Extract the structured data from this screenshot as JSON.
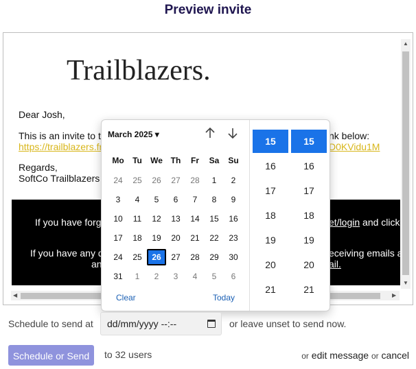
{
  "page_title": "Preview invite",
  "email": {
    "logo_text": "Trailblazers.",
    "greeting": "Dear Josh,",
    "intro_start": "This is an invite to t",
    "intro_end": "nk below:",
    "link_start": "https://trailblazers.fr",
    "link_end": "D0KVidu1M",
    "regards": "Regards,",
    "signature": "SoftCo Trailblazers",
    "footer_line1_start": "If you have forg",
    "footer_line1_link": "et/login",
    "footer_line1_end": " and click",
    "footer_line2_start": "If you have any q",
    "footer_line2_end": "eceiving emails a",
    "footer_line3_start": "an",
    "footer_line3_link": "ail."
  },
  "picker": {
    "month_label": "March 2025 ▾",
    "up_icon": "arrow-up-icon",
    "down_icon": "arrow-down-icon",
    "weekdays": [
      "Mo",
      "Tu",
      "We",
      "Th",
      "Fr",
      "Sa",
      "Su"
    ],
    "weeks": [
      [
        "24",
        "25",
        "26",
        "27",
        "28",
        "1",
        "2"
      ],
      [
        "3",
        "4",
        "5",
        "6",
        "7",
        "8",
        "9"
      ],
      [
        "10",
        "11",
        "12",
        "13",
        "14",
        "15",
        "16"
      ],
      [
        "17",
        "18",
        "19",
        "20",
        "21",
        "22",
        "23"
      ],
      [
        "24",
        "25",
        "26",
        "27",
        "28",
        "29",
        "30"
      ],
      [
        "31",
        "1",
        "2",
        "3",
        "4",
        "5",
        "6"
      ]
    ],
    "selected_day": "26",
    "clear_label": "Clear",
    "today_label": "Today",
    "hours": [
      "15",
      "16",
      "17",
      "18",
      "19",
      "20",
      "21"
    ],
    "minutes": [
      "15",
      "16",
      "17",
      "18",
      "19",
      "20",
      "21"
    ],
    "selected_hour": "15",
    "selected_minute": "15"
  },
  "schedule": {
    "label": "Schedule to send at",
    "input_value": "dd/mm/yyyy --:--",
    "hint": "or leave unset to send now."
  },
  "actions": {
    "send_label": "Schedule or Send",
    "recipients": "to 32 users",
    "or1": "or",
    "edit_label": "edit message",
    "or2": "or",
    "cancel_label": "cancel"
  },
  "colors": {
    "accent": "#1a73e8",
    "send_button": "#8f93dd",
    "title": "#1f1650",
    "link": "#d8b61a"
  }
}
